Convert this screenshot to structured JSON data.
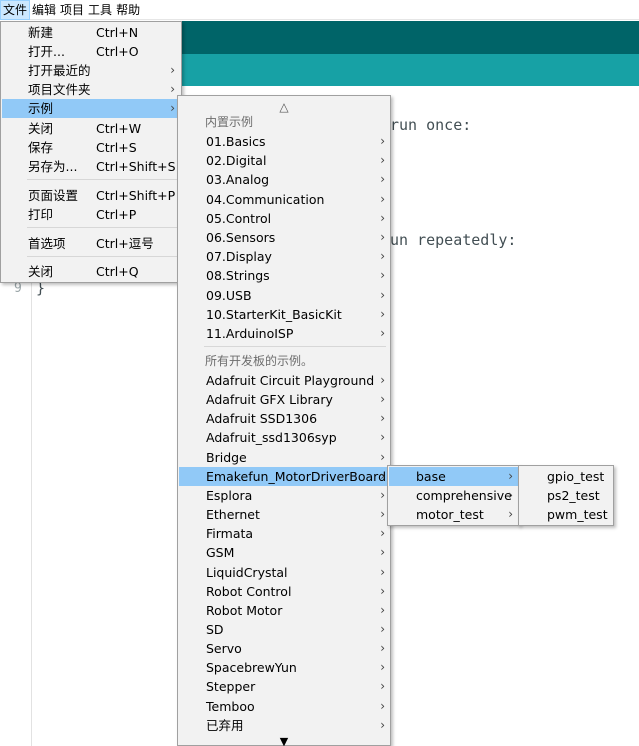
{
  "menubar": {
    "file": "文件",
    "edit": "编辑",
    "project": "项目",
    "tools": "工具",
    "help": "帮助"
  },
  "editor": {
    "line1": "run once:",
    "line2": "un repeatedly:",
    "line9_num": "9",
    "line9_text": "}"
  },
  "file_menu": {
    "items": [
      {
        "label": "新建",
        "shortcut": "Ctrl+N"
      },
      {
        "label": "打开...",
        "shortcut": "Ctrl+O"
      },
      {
        "label": "打开最近的",
        "shortcut": ""
      },
      {
        "label": "项目文件夹",
        "shortcut": ""
      },
      {
        "label": "示例",
        "shortcut": ""
      },
      {
        "label": "关闭",
        "shortcut": "Ctrl+W"
      },
      {
        "label": "保存",
        "shortcut": "Ctrl+S"
      },
      {
        "label": "另存为...",
        "shortcut": "Ctrl+Shift+S"
      },
      {
        "label": "页面设置",
        "shortcut": "Ctrl+Shift+P"
      },
      {
        "label": "打印",
        "shortcut": "Ctrl+P"
      },
      {
        "label": "首选项",
        "shortcut": "Ctrl+逗号"
      },
      {
        "label": "关闭",
        "shortcut": "Ctrl+Q"
      }
    ]
  },
  "examples_menu": {
    "scroll_up": "△",
    "scroll_down": "▼",
    "builtin_header": "内置示例",
    "builtin": [
      "01.Basics",
      "02.Digital",
      "03.Analog",
      "04.Communication",
      "05.Control",
      "06.Sensors",
      "07.Display",
      "08.Strings",
      "09.USB",
      "10.StarterKit_BasicKit",
      "11.ArduinoISP"
    ],
    "all_boards_header": "所有开发板的示例。",
    "libraries": [
      "Adafruit Circuit Playground",
      "Adafruit GFX Library",
      "Adafruit SSD1306",
      "Adafruit_ssd1306syp",
      "Bridge",
      "Emakefun_MotorDriverBoard",
      "Esplora",
      "Ethernet",
      "Firmata",
      "GSM",
      "LiquidCrystal",
      "Robot Control",
      "Robot Motor",
      "SD",
      "Servo",
      "SpacebrewYun",
      "Stepper",
      "Temboo",
      "已弃用"
    ]
  },
  "motor_menu": {
    "items": [
      "base",
      "comprehensive",
      "motor_test"
    ]
  },
  "base_menu": {
    "items": [
      "gpio_test",
      "ps2_test",
      "pwm_test"
    ]
  },
  "colors": {
    "toolbar": "#006468",
    "tabbar": "#17a1a5",
    "highlight": "#91c9f7",
    "menu_bg": "#f2f2f2"
  },
  "icons": {
    "submenu_arrow": "chevron-right-icon",
    "scroll_up": "triangle-up-icon",
    "scroll_down": "triangle-down-icon"
  }
}
